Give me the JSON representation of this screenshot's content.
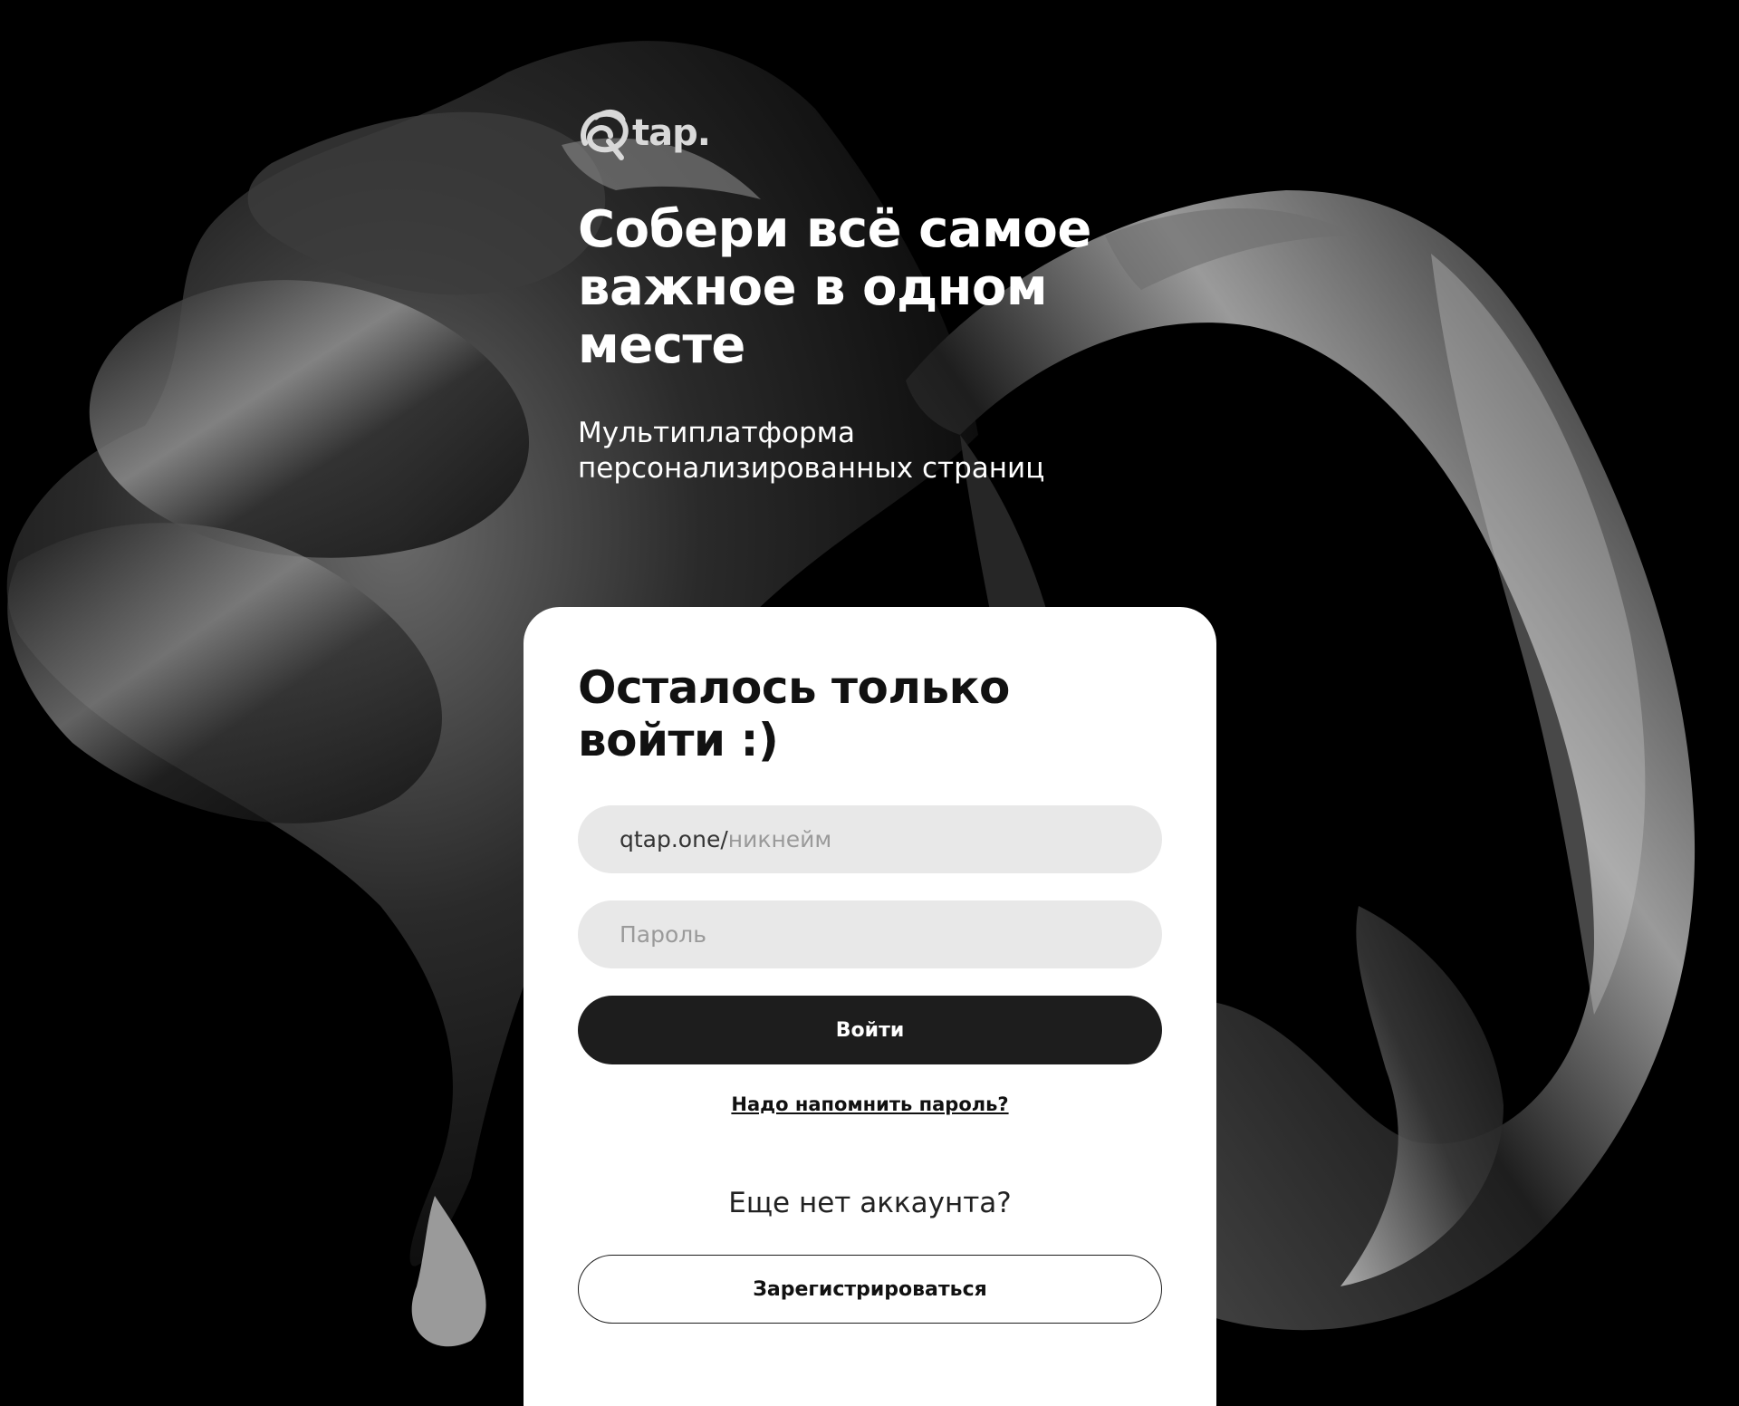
{
  "brand": {
    "logo_text": "tap."
  },
  "hero": {
    "headline_line1": "Собери всё самое",
    "headline_line2": "важное в одном",
    "headline_line3": "месте",
    "subtitle_line1": "Мультиплатформа",
    "subtitle_line2": "персонализированных страниц"
  },
  "login_card": {
    "title_line1": "Осталось только",
    "title_line2": "войти :)",
    "username_prefix": "qtap.one/",
    "username_placeholder": "никнейм",
    "password_placeholder": "Пароль",
    "login_button": "Войти",
    "forgot_password_link": "Надо напомнить пароль?",
    "no_account_text": "Еще нет аккаунта?",
    "register_button": "Зарегистрироваться"
  },
  "colors": {
    "background": "#000000",
    "card": "#ffffff",
    "field": "#e8e8e8",
    "primary_button": "#1d1d1d",
    "logo": "#d9d9d9"
  },
  "icons": {
    "background": "abstract-silk-fabric-art",
    "logo": "qtap-logo-icon"
  }
}
